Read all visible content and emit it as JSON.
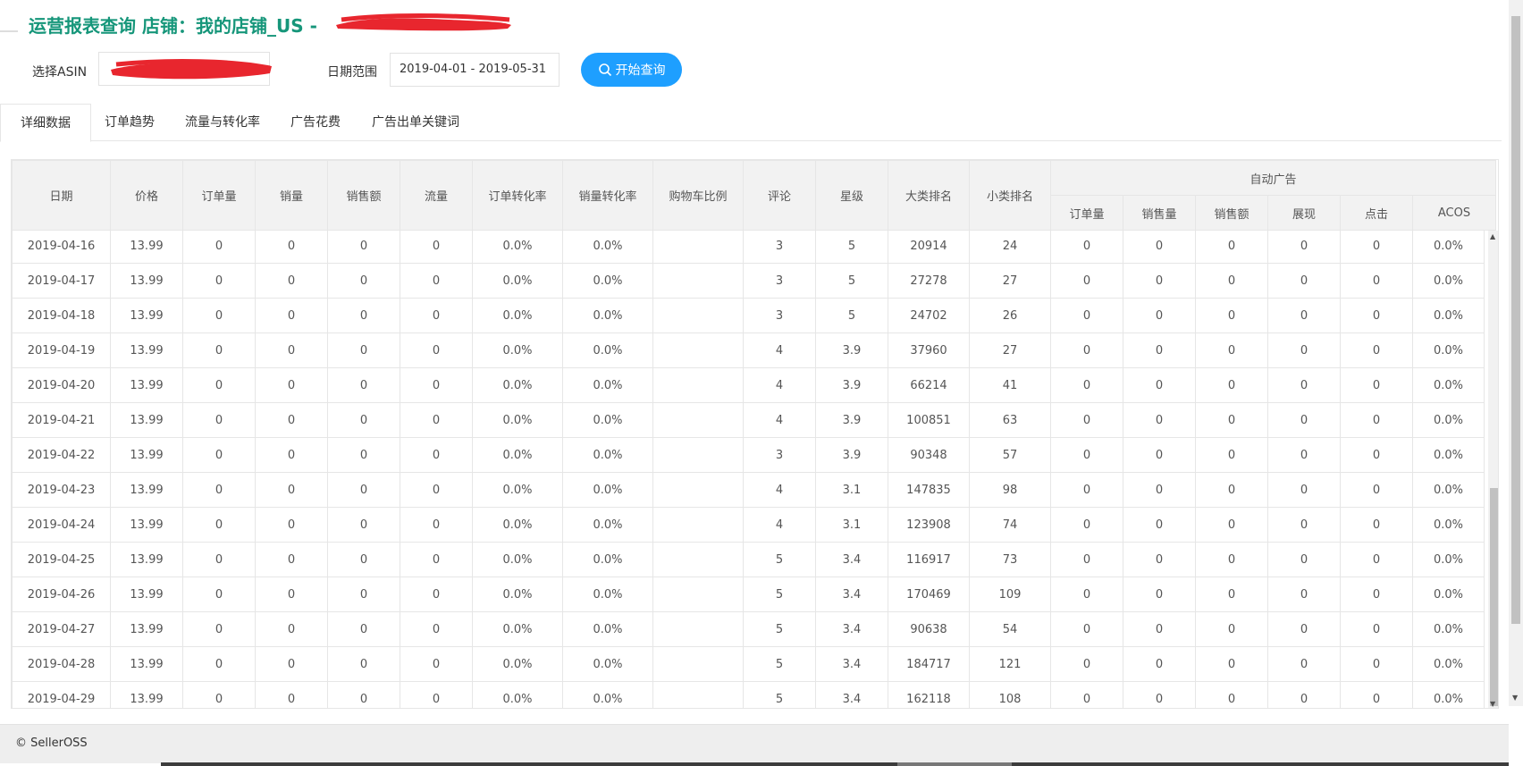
{
  "page": {
    "title": "运营报表查询 店铺：我的店铺_US -",
    "query": {
      "asin_label": "选择ASIN",
      "date_label": "日期范围",
      "date_value": "2019-04-01 - 2019-05-31",
      "query_button": "开始查询"
    }
  },
  "tabs": [
    {
      "label": "详细数据",
      "active": true
    },
    {
      "label": "订单趋势",
      "active": false
    },
    {
      "label": "流量与转化率",
      "active": false
    },
    {
      "label": "广告花费",
      "active": false
    },
    {
      "label": "广告出单关键词",
      "active": false
    }
  ],
  "table": {
    "group_header": "自动广告",
    "columns": [
      "日期",
      "价格",
      "订单量",
      "销量",
      "销售额",
      "流量",
      "订单转化率",
      "销量转化率",
      "购物车比例",
      "评论",
      "星级",
      "大类排名",
      "小类排名"
    ],
    "ad_columns": [
      "订单量",
      "销售量",
      "销售额",
      "展现",
      "点击",
      "ACOS"
    ],
    "rows": [
      [
        "2019-04-16",
        "13.99",
        "0",
        "0",
        "0",
        "0",
        "0.0%",
        "0.0%",
        "",
        "3",
        "5",
        "20914",
        "24",
        "0",
        "0",
        "0",
        "0",
        "0",
        "0.0%"
      ],
      [
        "2019-04-17",
        "13.99",
        "0",
        "0",
        "0",
        "0",
        "0.0%",
        "0.0%",
        "",
        "3",
        "5",
        "27278",
        "27",
        "0",
        "0",
        "0",
        "0",
        "0",
        "0.0%"
      ],
      [
        "2019-04-18",
        "13.99",
        "0",
        "0",
        "0",
        "0",
        "0.0%",
        "0.0%",
        "",
        "3",
        "5",
        "24702",
        "26",
        "0",
        "0",
        "0",
        "0",
        "0",
        "0.0%"
      ],
      [
        "2019-04-19",
        "13.99",
        "0",
        "0",
        "0",
        "0",
        "0.0%",
        "0.0%",
        "",
        "4",
        "3.9",
        "37960",
        "27",
        "0",
        "0",
        "0",
        "0",
        "0",
        "0.0%"
      ],
      [
        "2019-04-20",
        "13.99",
        "0",
        "0",
        "0",
        "0",
        "0.0%",
        "0.0%",
        "",
        "4",
        "3.9",
        "66214",
        "41",
        "0",
        "0",
        "0",
        "0",
        "0",
        "0.0%"
      ],
      [
        "2019-04-21",
        "13.99",
        "0",
        "0",
        "0",
        "0",
        "0.0%",
        "0.0%",
        "",
        "4",
        "3.9",
        "100851",
        "63",
        "0",
        "0",
        "0",
        "0",
        "0",
        "0.0%"
      ],
      [
        "2019-04-22",
        "13.99",
        "0",
        "0",
        "0",
        "0",
        "0.0%",
        "0.0%",
        "",
        "3",
        "3.9",
        "90348",
        "57",
        "0",
        "0",
        "0",
        "0",
        "0",
        "0.0%"
      ],
      [
        "2019-04-23",
        "13.99",
        "0",
        "0",
        "0",
        "0",
        "0.0%",
        "0.0%",
        "",
        "4",
        "3.1",
        "147835",
        "98",
        "0",
        "0",
        "0",
        "0",
        "0",
        "0.0%"
      ],
      [
        "2019-04-24",
        "13.99",
        "0",
        "0",
        "0",
        "0",
        "0.0%",
        "0.0%",
        "",
        "4",
        "3.1",
        "123908",
        "74",
        "0",
        "0",
        "0",
        "0",
        "0",
        "0.0%"
      ],
      [
        "2019-04-25",
        "13.99",
        "0",
        "0",
        "0",
        "0",
        "0.0%",
        "0.0%",
        "",
        "5",
        "3.4",
        "116917",
        "73",
        "0",
        "0",
        "0",
        "0",
        "0",
        "0.0%"
      ],
      [
        "2019-04-26",
        "13.99",
        "0",
        "0",
        "0",
        "0",
        "0.0%",
        "0.0%",
        "",
        "5",
        "3.4",
        "170469",
        "109",
        "0",
        "0",
        "0",
        "0",
        "0",
        "0.0%"
      ],
      [
        "2019-04-27",
        "13.99",
        "0",
        "0",
        "0",
        "0",
        "0.0%",
        "0.0%",
        "",
        "5",
        "3.4",
        "90638",
        "54",
        "0",
        "0",
        "0",
        "0",
        "0",
        "0.0%"
      ],
      [
        "2019-04-28",
        "13.99",
        "0",
        "0",
        "0",
        "0",
        "0.0%",
        "0.0%",
        "",
        "5",
        "3.4",
        "184717",
        "121",
        "0",
        "0",
        "0",
        "0",
        "0",
        "0.0%"
      ],
      [
        "2019-04-29",
        "13.99",
        "0",
        "0",
        "0",
        "0",
        "0.0%",
        "0.0%",
        "",
        "5",
        "3.4",
        "162118",
        "108",
        "0",
        "0",
        "0",
        "0",
        "0",
        "0.0%"
      ]
    ]
  },
  "footer": {
    "text": "© SellerOSS"
  },
  "colors": {
    "title": "#16967a",
    "button": "#1e9fff",
    "redaction": "#e8262e"
  },
  "icons": {
    "query_button_icon": "search-icon"
  }
}
